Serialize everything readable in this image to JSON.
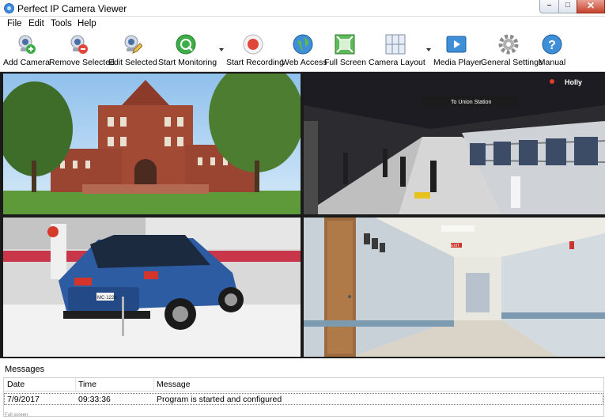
{
  "window": {
    "title": "Perfect IP Camera Viewer",
    "controls": {
      "minimize": "–",
      "maximize": "□",
      "close": "✕"
    }
  },
  "menu": [
    "File",
    "Edit",
    "Tools",
    "Help"
  ],
  "toolbar": {
    "add_camera": "Add Camera",
    "remove_selected": "Remove Selected",
    "edit_selected": "Edit Selected",
    "start_monitoring": "Start Monitoring",
    "start_recording": "Start Recording",
    "web_access": "Web Access",
    "full_screen": "Full Screen",
    "camera_layout": "Camera Layout",
    "media_player": "Media Player",
    "general_settings": "General Settings",
    "manual": "Manual"
  },
  "cameras": [
    {
      "scene": "university building with lawn and trees"
    },
    {
      "scene": "subway station platform",
      "sign": "To Union Station",
      "overlay": "Holly"
    },
    {
      "scene": "blue SUV in parking garage",
      "plate": "MC·1224"
    },
    {
      "scene": "hospital corridor with door",
      "sign": "EXIT"
    }
  ],
  "messages": {
    "title": "Messages",
    "columns": [
      "Date",
      "Time",
      "Message"
    ],
    "rows": [
      {
        "date": "7/9/2017",
        "time": "09:33:36",
        "message": "Program is started and configured"
      }
    ]
  },
  "status_text": "Full screen",
  "colors": {
    "accent": "#3d8ad9",
    "record": "#e0473a",
    "monitor": "#3fae49"
  }
}
